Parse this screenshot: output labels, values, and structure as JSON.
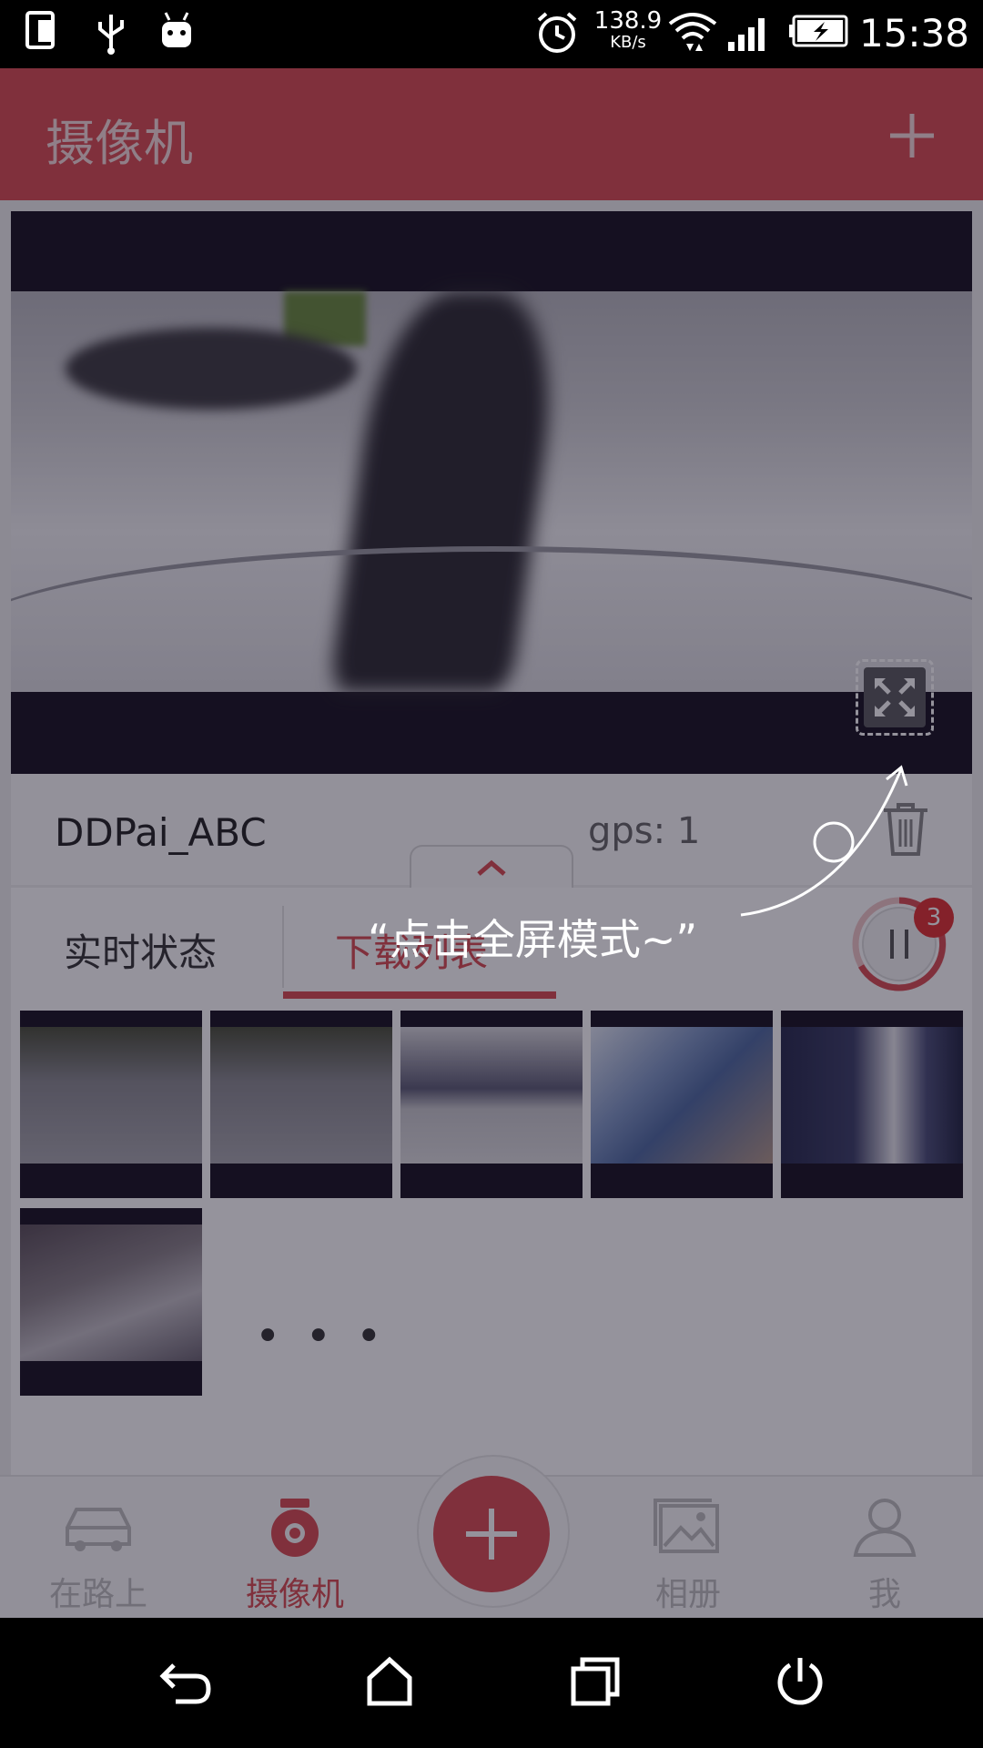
{
  "status_bar": {
    "net_speed_value": "138.9",
    "net_speed_unit": "KB/s",
    "time": "15:38"
  },
  "header": {
    "title": "摄像机",
    "add_icon": "plus-icon"
  },
  "player": {
    "fullscreen_icon": "fullscreen-icon"
  },
  "device": {
    "name": "DDPai_ABC",
    "gps": "gps: 1"
  },
  "tabs": {
    "live": "实时状态",
    "download": "下载列表"
  },
  "download": {
    "pending_count": "3"
  },
  "thumbnails": {
    "more": "• • •"
  },
  "tooltip": {
    "text": "“点击全屏模式~”"
  },
  "bottom_nav": {
    "on_road": "在路上",
    "camera": "摄像机",
    "album": "相册",
    "me": "我"
  },
  "colors": {
    "brand": "#d94c50"
  }
}
